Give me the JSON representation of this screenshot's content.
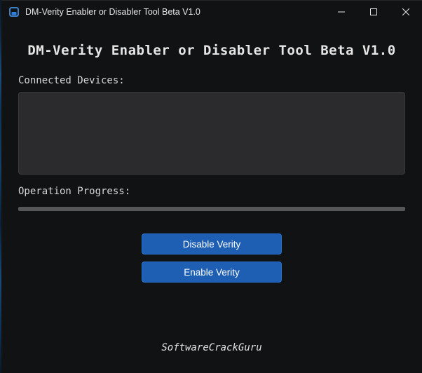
{
  "window": {
    "title": "DM-Verity Enabler or Disabler Tool Beta V1.0"
  },
  "header": {
    "title": "DM-Verity Enabler or Disabler Tool Beta V1.0"
  },
  "sections": {
    "devices_label": "Connected Devices:",
    "progress_label": "Operation Progress:"
  },
  "buttons": {
    "disable": "Disable Verity",
    "enable": "Enable Verity"
  },
  "footer": {
    "credit": "SoftwareCrackGuru"
  },
  "progress": {
    "value": 0
  },
  "colors": {
    "accent": "#1e5fb3",
    "background": "#111214",
    "panel": "#2b2b2d"
  }
}
